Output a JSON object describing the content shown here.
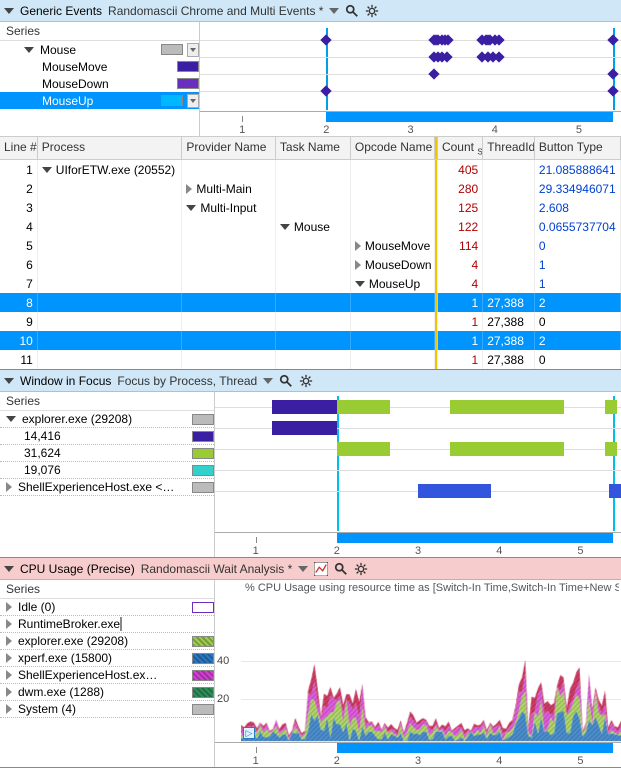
{
  "panel1": {
    "title": "Generic Events",
    "preset": "Randomascii Chrome and Multi Events *",
    "series_head": "Series",
    "series": [
      {
        "label": "Mouse",
        "indent": 1,
        "color": "#bbbbbb",
        "exp": "down",
        "dropdown": true
      },
      {
        "label": "MouseMove",
        "indent": 2,
        "color": "#3b1fa3"
      },
      {
        "label": "MouseDown",
        "indent": 2,
        "color": "#6a2fbf"
      },
      {
        "label": "MouseUp",
        "indent": 2,
        "color": "#00b8ff",
        "selected": true,
        "dropdown": true
      }
    ],
    "axis": {
      "ticks": [
        "1",
        "2",
        "3",
        "4",
        "5"
      ],
      "sel_start": 0.3,
      "sel_end": 0.98
    },
    "marks": {
      "vlines": [
        0.3,
        0.98
      ],
      "cluster_rows": [
        {
          "y": 14,
          "diamonds": [
            0.3,
            0.555,
            0.56,
            0.565,
            0.575,
            0.582,
            0.59,
            0.67,
            0.68,
            0.685,
            0.69,
            0.7,
            0.71,
            0.98
          ]
        },
        {
          "y": 31,
          "diamonds": [
            0.555,
            0.565,
            0.576,
            0.586,
            0.67,
            0.683,
            0.695,
            0.71
          ]
        },
        {
          "y": 48,
          "diamonds": [
            0.555,
            0.98
          ]
        },
        {
          "y": 65,
          "diamonds": [
            0.3,
            0.98
          ]
        }
      ]
    }
  },
  "chart_data": {
    "type": "table",
    "columns": [
      "Line #",
      "Process",
      "Provider Name",
      "Task Name",
      "Opcode Name",
      "Count (Sum)",
      "ThreadId",
      "Button Type"
    ],
    "rows": [
      {
        "line": "1",
        "proc": "UIforETW.exe (20552)",
        "proc_exp": "down",
        "prov": "",
        "task": "",
        "op": "",
        "count": "405",
        "thread": "",
        "btn": "21.085888641",
        "blue": true
      },
      {
        "line": "2",
        "proc": "",
        "prov": "Multi-Main",
        "prov_exp": "right",
        "task": "",
        "op": "",
        "count": "280",
        "thread": "",
        "btn": "29.334946071",
        "blue": true
      },
      {
        "line": "3",
        "proc": "",
        "prov": "Multi-Input",
        "prov_exp": "down",
        "task": "",
        "op": "",
        "count": "125",
        "thread": "",
        "btn": "2.608",
        "blue": true
      },
      {
        "line": "4",
        "proc": "",
        "prov": "",
        "task": "Mouse",
        "task_exp": "down",
        "op": "",
        "count": "122",
        "thread": "",
        "btn": "0.0655737704",
        "blue": true
      },
      {
        "line": "5",
        "proc": "",
        "prov": "",
        "task": "",
        "op": "MouseMove",
        "op_exp": "right",
        "count": "114",
        "thread": "",
        "btn": "0",
        "blue": true
      },
      {
        "line": "6",
        "proc": "",
        "prov": "",
        "task": "",
        "op": "MouseDown",
        "op_exp": "right",
        "count": "4",
        "thread": "",
        "btn": "1",
        "blue": true
      },
      {
        "line": "7",
        "proc": "",
        "prov": "",
        "task": "",
        "op": "MouseUp",
        "op_exp": "down",
        "count": "4",
        "thread": "",
        "btn": "1",
        "blue": true
      },
      {
        "line": "8",
        "proc": "",
        "prov": "",
        "task": "",
        "op": "",
        "count": "1",
        "thread": "27,388",
        "btn": "2",
        "sel": true
      },
      {
        "line": "9",
        "proc": "",
        "prov": "",
        "task": "",
        "op": "",
        "count": "1",
        "thread": "27,388",
        "btn": "0"
      },
      {
        "line": "10",
        "proc": "",
        "prov": "",
        "task": "",
        "op": "",
        "count": "1",
        "thread": "27,388",
        "btn": "2",
        "sel": true
      },
      {
        "line": "11",
        "proc": "",
        "prov": "",
        "task": "",
        "op": "",
        "count": "1",
        "thread": "27,388",
        "btn": "0"
      }
    ]
  },
  "panel2": {
    "title": "Window in Focus",
    "preset": "Focus by Process, Thread",
    "series_head": "Series",
    "series": [
      {
        "label": "explorer.exe (29208)",
        "indent": 0,
        "color": "#bbbbbb",
        "exp": "down"
      },
      {
        "label": "14,416",
        "indent": 1,
        "color": "#3b1fa3"
      },
      {
        "label": "31,624",
        "indent": 1,
        "color": "#99cc33"
      },
      {
        "label": "19,076",
        "indent": 1,
        "color": "#33d1cc"
      },
      {
        "label": "ShellExperienceHost.exe <…",
        "indent": 0,
        "color": "#bbbbbb",
        "exp": "right"
      }
    ],
    "axis": {
      "ticks": [
        "1",
        "2",
        "3",
        "4",
        "5"
      ],
      "sel_start": 0.3,
      "sel_end": 0.98
    },
    "blocks": [
      {
        "row": 0,
        "segs": [
          [
            0.14,
            0.3,
            "#3b1fa3"
          ],
          [
            0.3,
            0.43,
            "#99cc33"
          ],
          [
            0.58,
            0.86,
            "#99cc33"
          ],
          [
            0.96,
            0.99,
            "#99cc33"
          ]
        ]
      },
      {
        "row": 1,
        "segs": [
          [
            0.14,
            0.3,
            "#3b1fa3"
          ]
        ]
      },
      {
        "row": 2,
        "segs": [
          [
            0.3,
            0.43,
            "#99cc33"
          ],
          [
            0.58,
            0.86,
            "#99cc33"
          ],
          [
            0.96,
            0.99,
            "#99cc33"
          ]
        ]
      },
      {
        "row": 3,
        "segs": []
      },
      {
        "row": 4,
        "segs": [
          [
            0.5,
            0.68,
            "#3355dd"
          ],
          [
            0.97,
            1.0,
            "#3355dd"
          ]
        ]
      }
    ]
  },
  "panel3": {
    "title": "CPU Usage (Precise)",
    "preset": "Randomascii Wait Analysis *",
    "series_head": "Series",
    "chart_label": "% CPU Usage using resource time as  [Switch-In Time,Switch-In Time+New Switch",
    "series": [
      {
        "label": "Idle (0)",
        "indent": 0,
        "color": "#ffffff",
        "border": "#6a2fbf",
        "exp": "right"
      },
      {
        "label": "RuntimeBroker.exe <M…",
        "indent": 0,
        "color": "#c61a4a",
        "hatch": true,
        "exp": "right"
      },
      {
        "label": "explorer.exe (29208)",
        "indent": 0,
        "color": "#9fce4e",
        "hatch": true,
        "exp": "right"
      },
      {
        "label": "xperf.exe (15800)",
        "indent": 0,
        "color": "#2a79c4",
        "hatch": true,
        "exp": "right"
      },
      {
        "label": "ShellExperienceHost.ex…",
        "indent": 0,
        "color": "#d63fd6",
        "hatch": true,
        "exp": "right"
      },
      {
        "label": "dwm.exe (1288)",
        "indent": 0,
        "color": "#2e8f5a",
        "hatch": true,
        "dark": "#8b1f1f",
        "exp": "right"
      },
      {
        "label": "System (4)",
        "indent": 0,
        "color": "#bbbbbb",
        "exp": "right"
      }
    ],
    "axis": {
      "ticks": [
        "1",
        "2",
        "3",
        "4",
        "5"
      ],
      "sel_start": 0.3,
      "sel_end": 0.98
    },
    "yticks": [
      "20",
      "40"
    ]
  }
}
